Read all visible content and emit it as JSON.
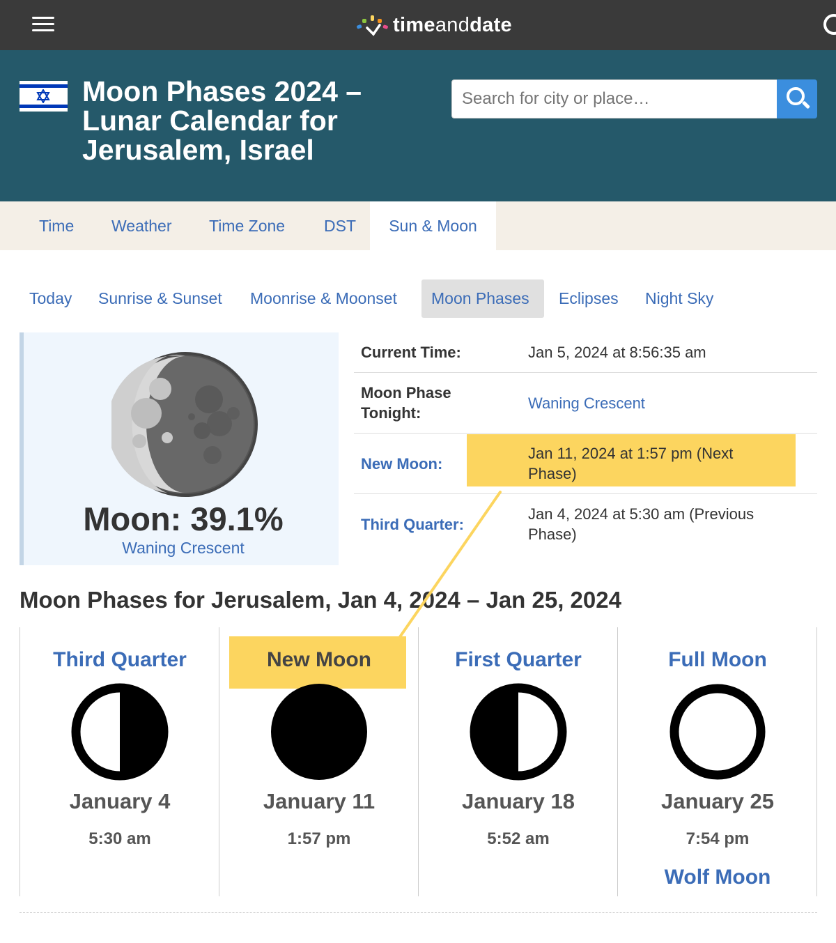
{
  "topbar": {
    "logo_bold": "time",
    "logo_thin": "and",
    "logo_bold2": "date",
    "menu_icon": "hamburger-icon",
    "search_icon": "search-icon"
  },
  "header": {
    "title": "Moon Phases 2024 – Lunar Calendar for Jerusalem, Israel",
    "search_placeholder": "Search for city or place…",
    "flag": "israel-flag-icon"
  },
  "main_nav": [
    "Time",
    "Weather",
    "Time Zone",
    "DST",
    "Sun & Moon"
  ],
  "main_nav_active": "Sun & Moon",
  "sub_nav": [
    "Today",
    "Sunrise & Sunset",
    "Moonrise & Moonset",
    "Moon Phases",
    "Eclipses",
    "Night Sky"
  ],
  "sub_nav_active": "Moon Phases",
  "moon_box": {
    "percentage": "Moon: 39.1%",
    "phase": "Waning Crescent"
  },
  "info": {
    "current_time_label": "Current Time:",
    "current_time_value": "Jan 5, 2024 at 8:56:35 am",
    "tonight_label": "Moon Phase Tonight:",
    "tonight_value": "Waning Crescent",
    "new_moon_label": "New Moon:",
    "new_moon_value": "Jan 11, 2024 at 1:57 pm (Next Phase)",
    "third_quarter_label": "Third Quarter:",
    "third_quarter_value": "Jan 4, 2024 at 5:30 am (Previous Phase)"
  },
  "section_title": "Moon Phases for Jerusalem, Jan 4, 2024 – Jan 25, 2024",
  "phases": [
    {
      "name": "Third Quarter",
      "date": "January 4",
      "time": "5:30 am",
      "extra": ""
    },
    {
      "name": "New Moon",
      "date": "January 11",
      "time": "1:57 pm",
      "extra": ""
    },
    {
      "name": "First Quarter",
      "date": "January 18",
      "time": "5:52 am",
      "extra": ""
    },
    {
      "name": "Full Moon",
      "date": "January 25",
      "time": "7:54 pm",
      "extra": "Wolf Moon"
    }
  ],
  "colors": {
    "topbar": "#3a3a3a",
    "header": "#25596a",
    "link": "#3b6cb7",
    "highlight": "#fcd55f",
    "search_button": "#3b8ede"
  }
}
